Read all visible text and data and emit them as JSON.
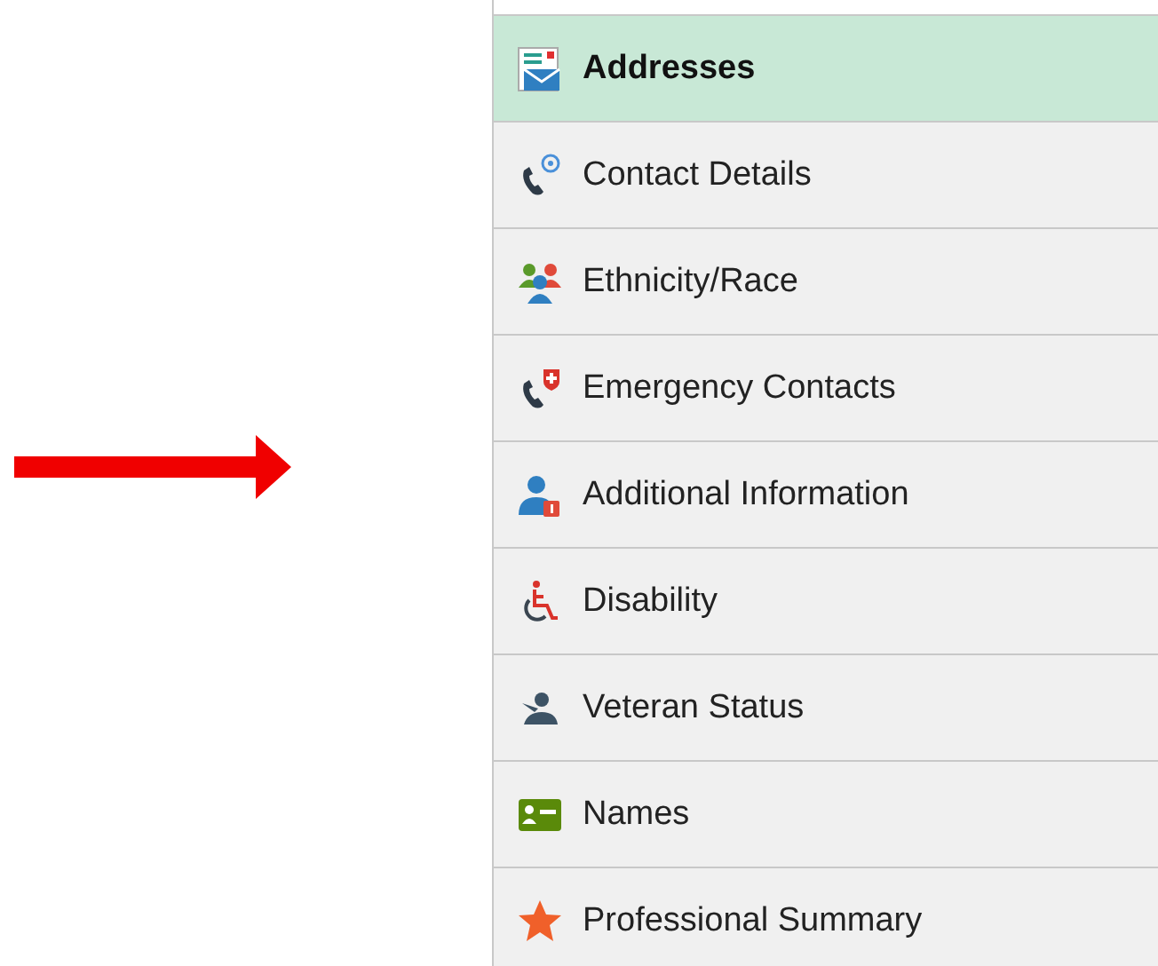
{
  "menu": {
    "items": [
      {
        "label": "Addresses",
        "kind": "addresses",
        "selected": true
      },
      {
        "label": "Contact Details",
        "kind": "contact",
        "selected": false
      },
      {
        "label": "Ethnicity/Race",
        "kind": "people",
        "selected": false
      },
      {
        "label": "Emergency Contacts",
        "kind": "emergency",
        "selected": false
      },
      {
        "label": "Additional Information",
        "kind": "person",
        "selected": false
      },
      {
        "label": "Disability",
        "kind": "wheelchair",
        "selected": false
      },
      {
        "label": "Veteran Status",
        "kind": "veteran",
        "selected": false
      },
      {
        "label": "Names",
        "kind": "names",
        "selected": false
      },
      {
        "label": "Professional Summary",
        "kind": "star",
        "selected": false
      }
    ]
  }
}
